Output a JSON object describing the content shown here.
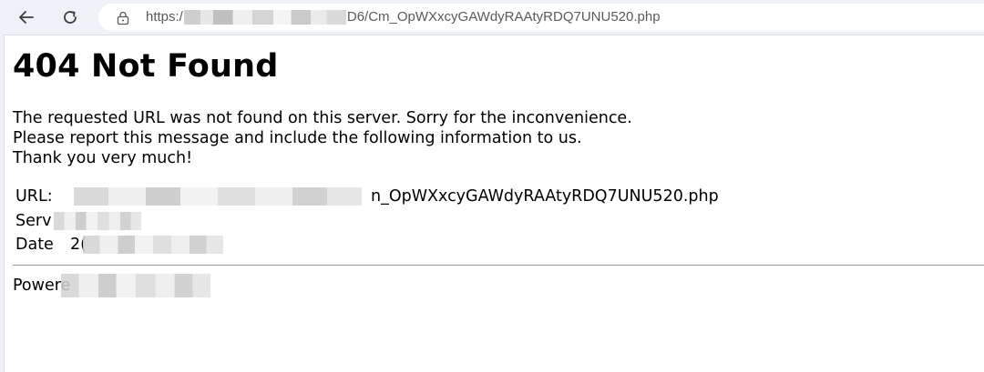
{
  "browser": {
    "url_prefix": "https:/",
    "url_suffix": "D6/Cm_OpWXxcyGAWdyRAAtyRDQ7UNU520.php",
    "back_icon": "arrow-left-icon",
    "reload_icon": "reload-icon",
    "lock_icon": "lock-icon"
  },
  "page": {
    "title": "404 Not Found",
    "message_lines": [
      "The requested URL was not found on this server. Sorry for the inconvenience.",
      "Please report this message and include the following information to us.",
      "Thank you very much!"
    ],
    "info": {
      "url_label": "URL:",
      "url_value_visible": "n_OpWXxcyGAWdyRAAtyRDQ7UNU520.php",
      "server_label": "Serv",
      "date_label": "Date",
      "date_value_visible": "2("
    },
    "powered_by": "Powere"
  }
}
